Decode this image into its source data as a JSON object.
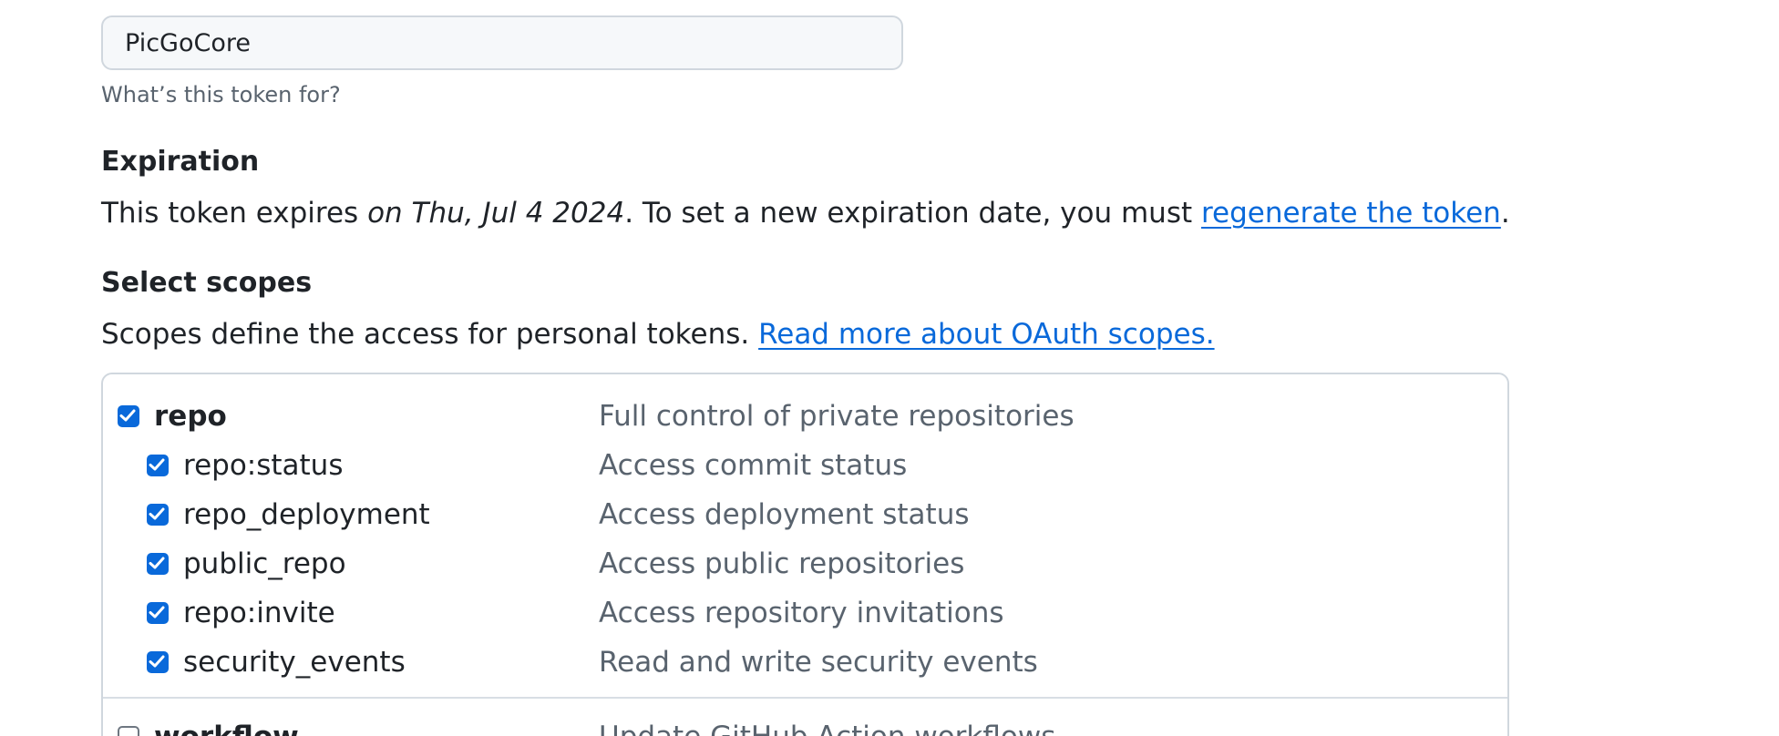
{
  "token_name": {
    "value": "PicGoCore",
    "hint": "What’s this token for?"
  },
  "expiration": {
    "heading": "Expiration",
    "text_before": "This token expires ",
    "date": "on Thu, Jul 4 2024",
    "text_after": ". To set a new expiration date, you must ",
    "link": "regenerate the token",
    "period": "."
  },
  "scopes": {
    "heading": "Select scopes",
    "description": "Scopes define the access for personal tokens. ",
    "link": "Read more about OAuth scopes.",
    "groups": [
      {
        "name": "repo",
        "checked": true,
        "description": "Full control of private repositories",
        "children": [
          {
            "name": "repo:status",
            "checked": true,
            "description": "Access commit status"
          },
          {
            "name": "repo_deployment",
            "checked": true,
            "description": "Access deployment status"
          },
          {
            "name": "public_repo",
            "checked": true,
            "description": "Access public repositories"
          },
          {
            "name": "repo:invite",
            "checked": true,
            "description": "Access repository invitations"
          },
          {
            "name": "security_events",
            "checked": true,
            "description": "Read and write security events"
          }
        ]
      },
      {
        "name": "workflow",
        "checked": false,
        "description": "Update GitHub Action workflows"
      }
    ]
  },
  "colors": {
    "link": "#0969da",
    "checkbox": "#0969da",
    "muted_text": "#59636e",
    "border": "#d0d7de"
  }
}
